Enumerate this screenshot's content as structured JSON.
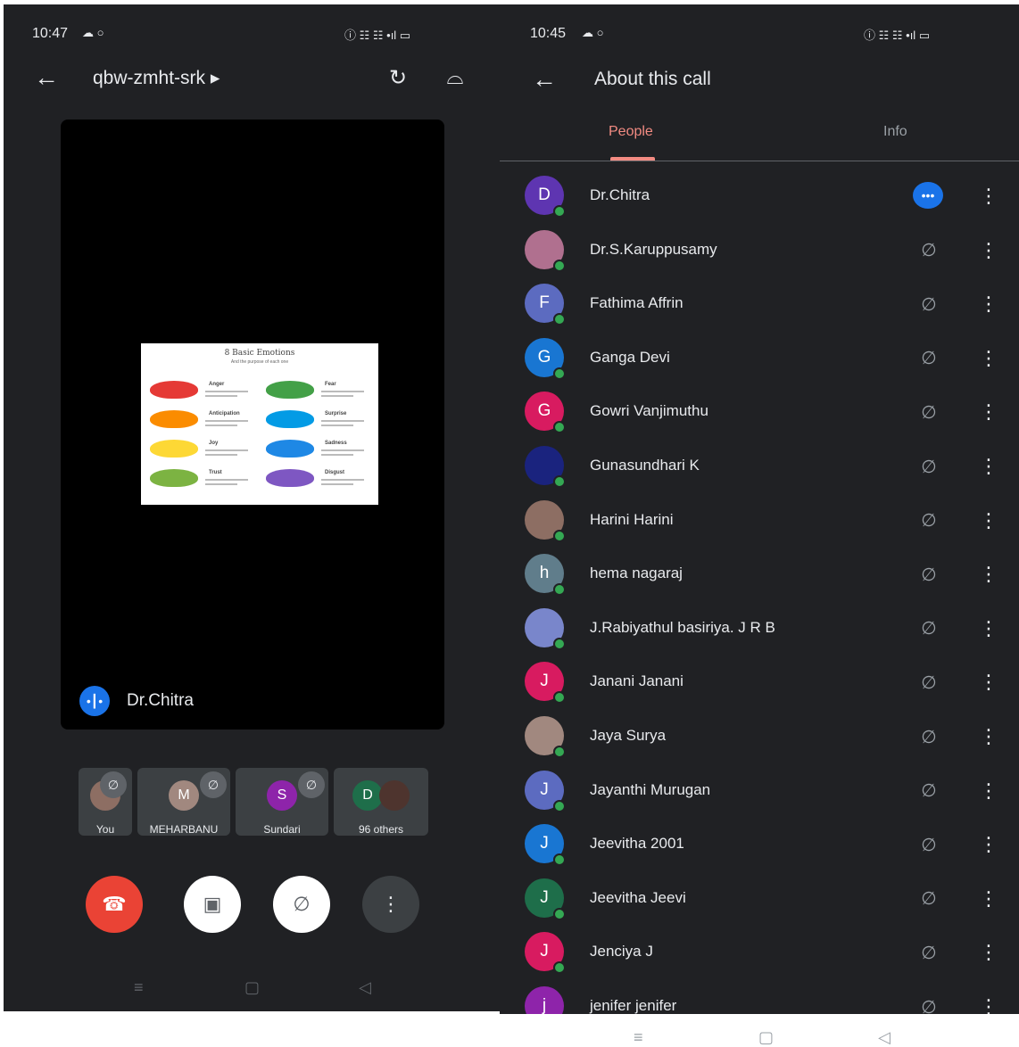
{
  "left": {
    "status": {
      "time": "10:47",
      "icons": "☁ ○",
      "right_icons": "ⓘ ☷ ☷ •ıl ▭"
    },
    "header": {
      "back": "←",
      "meeting_code": "qbw-zmht-srk ▸",
      "camera_switch_icon": "↻",
      "audio_icon": "⌓"
    },
    "slide": {
      "title": "8 Basic Emotions",
      "subtitle": "And the purpose of each one",
      "emotions": [
        "Anger",
        "Fear",
        "Anticipation",
        "Surprise",
        "Joy",
        "Sadness",
        "Trust",
        "Disgust"
      ],
      "colors": [
        "#e53935",
        "#43a047",
        "#fb8c00",
        "#039be5",
        "#fdd835",
        "#1e88e5",
        "#7cb342",
        "#7e57c2"
      ]
    },
    "presenter": {
      "name": "Dr.Chitra",
      "chip_icon": "•┃•"
    },
    "tiles": [
      {
        "label": "You",
        "initial": "",
        "color": "#8d6e63"
      },
      {
        "label": "MEHARBANU",
        "initial": "M",
        "color": "#a1887f"
      },
      {
        "label": "Sundari",
        "initial": "S",
        "color": "#8e24aa"
      },
      {
        "label": "96 others",
        "initial": "D",
        "color": "#1e6e4a"
      }
    ],
    "controls": {
      "end_call_icon": "☎",
      "camera_off_icon": "▣",
      "mic_off_icon": "∅",
      "more_icon": "⋮"
    },
    "nav": {
      "recent": "≡",
      "home": "▢",
      "back": "◁"
    }
  },
  "right": {
    "status": {
      "time": "10:45",
      "icons": "☁ ○",
      "right_icons": "ⓘ ☷ ☷ •ıl ▭"
    },
    "header": {
      "back": "←",
      "title": "About this call"
    },
    "tabs": [
      {
        "label": "People",
        "active": true
      },
      {
        "label": "Info",
        "active": false
      }
    ],
    "participants": [
      {
        "name": "Dr.Chitra",
        "initial": "D",
        "color": "#5e35b1",
        "speaking": true
      },
      {
        "name": "Dr.S.Karuppusamy",
        "initial": "",
        "color": "#b0708f",
        "speaking": false
      },
      {
        "name": "Fathima Affrin",
        "initial": "F",
        "color": "#5c6bc0",
        "speaking": false
      },
      {
        "name": "Ganga Devi",
        "initial": "G",
        "color": "#1976d2",
        "speaking": false
      },
      {
        "name": "Gowri Vanjimuthu",
        "initial": "G",
        "color": "#d81b60",
        "speaking": false
      },
      {
        "name": "Gunasundhari K",
        "initial": "",
        "color": "#1a237e",
        "speaking": false
      },
      {
        "name": "Harini Harini",
        "initial": "",
        "color": "#8d6e63",
        "speaking": false
      },
      {
        "name": "hema nagaraj",
        "initial": "h",
        "color": "#607d8b",
        "speaking": false
      },
      {
        "name": "J.Rabiyathul basiriya. J R B",
        "initial": "",
        "color": "#7986cb",
        "speaking": false
      },
      {
        "name": "Janani Janani",
        "initial": "J",
        "color": "#d81b60",
        "speaking": false
      },
      {
        "name": "Jaya Surya",
        "initial": "",
        "color": "#a1887f",
        "speaking": false
      },
      {
        "name": "Jayanthi Murugan",
        "initial": "J",
        "color": "#5c6bc0",
        "speaking": false
      },
      {
        "name": "Jeevitha 2001",
        "initial": "J",
        "color": "#1976d2",
        "speaking": false
      },
      {
        "name": "Jeevitha Jeevi",
        "initial": "J",
        "color": "#1e6e4a",
        "speaking": false
      },
      {
        "name": "Jenciya J",
        "initial": "J",
        "color": "#d81b60",
        "speaking": false
      },
      {
        "name": "jenifer jenifer",
        "initial": "j",
        "color": "#8e24aa",
        "speaking": false
      }
    ],
    "mic_off_icon": "∅",
    "more_icon": "⋮",
    "speaking_icon": "•••",
    "nav": {
      "recent": "≡",
      "home": "▢",
      "back": "◁"
    }
  }
}
